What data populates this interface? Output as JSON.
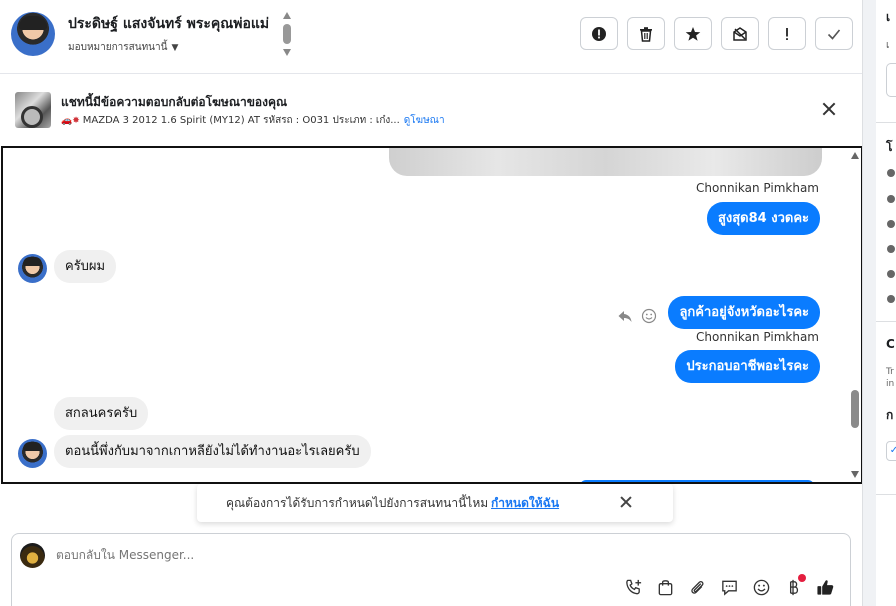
{
  "header": {
    "contact_name": "ประดิษฐ์ แสงจันทร์ พระคุณพ่อแม่",
    "assign_label": "มอบหมายการสนทนานี้",
    "actions": [
      {
        "name": "spam-icon"
      },
      {
        "name": "trash-icon"
      },
      {
        "name": "star-icon"
      },
      {
        "name": "mark-unread-icon"
      },
      {
        "name": "exclamation-icon"
      },
      {
        "name": "check-icon"
      }
    ]
  },
  "ad_bar": {
    "title": "แชทนี้มีข้อความตอบกลับต่อโฆษณาของคุณ",
    "description": "MAZDA 3 2012 1.6 Spirit (MY12) AT รหัสรถ : O031 ประเภท : เก๋ง...",
    "link": "ดูโฆษณา"
  },
  "thread": {
    "messages": [
      {
        "type": "sender",
        "text": "Chonnikan Pimkham"
      },
      {
        "type": "outgoing",
        "text": "สูงสุด84 งวดคะ"
      },
      {
        "type": "incoming",
        "text": "ครับผม"
      },
      {
        "type": "outgoing",
        "text": "ลูกค้าอยู่จังหวัดอะไรคะ"
      },
      {
        "type": "sender",
        "text": "Chonnikan Pimkham"
      },
      {
        "type": "outgoing",
        "text": "ประกอบอาชีพอะไรคะ"
      },
      {
        "type": "incoming",
        "text": "สกลนครครับ"
      },
      {
        "type": "incoming",
        "text": "ตอนนี้พึ่งกับมาจากเกาหลียังไม่ได้ทำงานอะไรเลยครับ"
      }
    ]
  },
  "assignment_prompt": {
    "text": "คุณต้องการได้รับการกำหนดไปยังการสนทนานี้ไหม",
    "link": "กำหนดให้ฉัน"
  },
  "composer": {
    "placeholder": "ตอบกลับใน Messenger..."
  },
  "right_column": {
    "frag_a": "เ",
    "frag_b": "เ",
    "frag_c": "โ",
    "frag_d": "C",
    "frag_e": "Tr in",
    "frag_f": "ก"
  },
  "colors": {
    "accent": "#0a7cff",
    "link": "#1877f2",
    "incoming_bubble": "#f0f0f0"
  }
}
